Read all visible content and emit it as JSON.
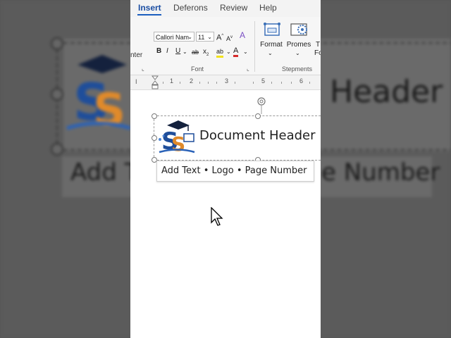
{
  "ribbon": {
    "tabs": [
      "Insert",
      "Deferons",
      "Review",
      "Help"
    ],
    "font_name": "Callori Nam",
    "font_size": "11",
    "font_group_label": "Font",
    "center_label": "nter",
    "format_label": "Format",
    "promes_label": "Promes",
    "stepments_label": "Stepments",
    "t_label": "T",
    "fo_label": "Fo",
    "grow_font": "A",
    "shrink_font": "A",
    "bold": "B",
    "italic": "I",
    "underline": "U",
    "strike": "ab",
    "subscript": "x",
    "highlight": "ab",
    "font_color": "A",
    "clear_format": "A"
  },
  "ruler": {
    "numbers": [
      "1",
      "2",
      "3",
      "5",
      "6"
    ]
  },
  "document": {
    "title": "Document Header",
    "subtitle": "Add Text • Logo • Page Number"
  },
  "background": {
    "header_text": "Header",
    "add_text": "Add T",
    "number_text": "e Number"
  },
  "colors": {
    "accent": "#1b5ebf",
    "logo_blue": "#1f4e9a",
    "logo_orange": "#e08a2a"
  }
}
